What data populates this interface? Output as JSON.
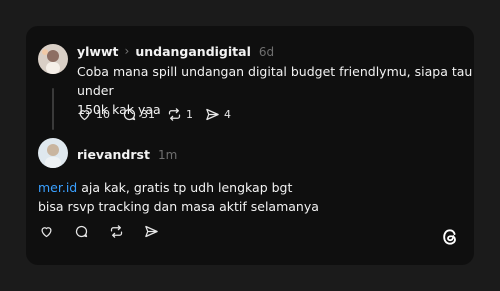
{
  "post": {
    "author": "ylwwt",
    "reply_to": "undangandigital",
    "time": "6d",
    "text_line1": "Coba mana spill undangan digital budget friendlymu, siapa tau under",
    "text_line2": "150k kak yaa",
    "stats": {
      "likes": "10",
      "comments": "31",
      "reposts": "1",
      "shares": "4"
    }
  },
  "reply": {
    "author": "rievandrst",
    "time": "1m",
    "link": "mer.id",
    "text_line1_rest": " aja kak, gratis tp udh lengkap bgt",
    "text_line2": "bisa rsvp tracking dan masa aktif selamanya"
  },
  "icons": {
    "like": "heart-icon",
    "comment": "comment-icon",
    "repost": "repost-icon",
    "share": "share-icon",
    "logo": "threads-logo-icon"
  }
}
